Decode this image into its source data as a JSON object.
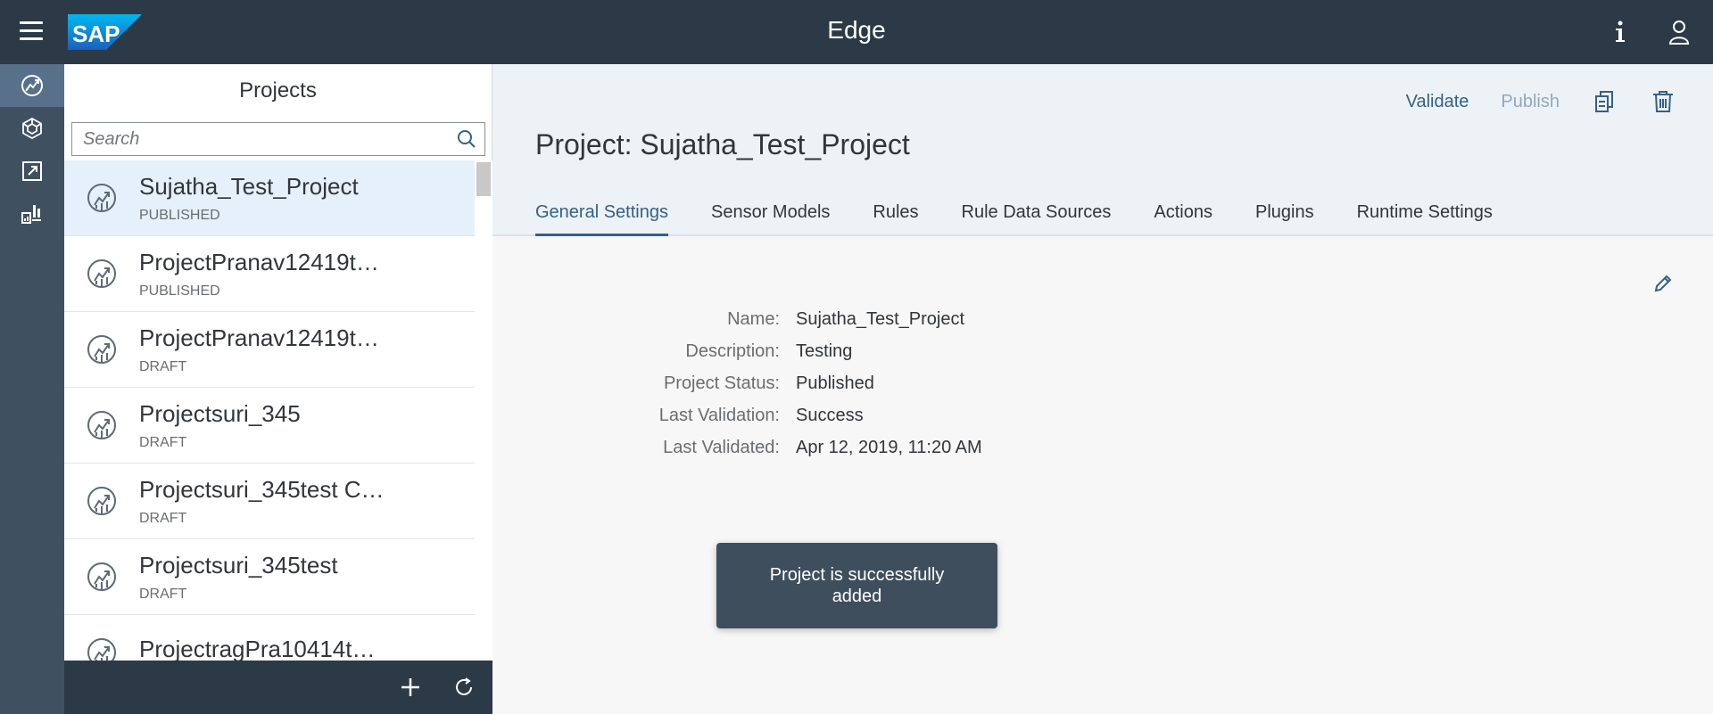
{
  "shell": {
    "title": "Edge",
    "logo_text": "SAP",
    "colors": {
      "shellbar": "#2c3a47",
      "navrail": "#3f5161",
      "accent": "#346187"
    }
  },
  "navrail": {
    "items": [
      {
        "icon": "projects-icon",
        "active": true
      },
      {
        "icon": "sensor-models-icon",
        "active": false
      },
      {
        "icon": "external-link-icon",
        "active": false
      },
      {
        "icon": "dashboard-icon",
        "active": false
      }
    ]
  },
  "master": {
    "title": "Projects",
    "search_placeholder": "Search",
    "items": [
      {
        "title": "Sujatha_Test_Project",
        "status": "PUBLISHED"
      },
      {
        "title": "ProjectPranav12419t…",
        "status": "PUBLISHED"
      },
      {
        "title": "ProjectPranav12419t…",
        "status": "DRAFT"
      },
      {
        "title": "Projectsuri_345",
        "status": "DRAFT"
      },
      {
        "title": "Projectsuri_345test C…",
        "status": "DRAFT"
      },
      {
        "title": "Projectsuri_345test",
        "status": "DRAFT"
      },
      {
        "title": "ProjectragPra10414t…",
        "status": ""
      }
    ]
  },
  "detail": {
    "title": "Project: Sujatha_Test_Project",
    "actions": {
      "validate": "Validate",
      "publish": "Publish"
    },
    "tabs": [
      {
        "label": "General Settings"
      },
      {
        "label": "Sensor Models"
      },
      {
        "label": "Rules"
      },
      {
        "label": "Rule Data Sources"
      },
      {
        "label": "Actions"
      },
      {
        "label": "Plugins"
      },
      {
        "label": "Runtime Settings"
      }
    ],
    "form": {
      "name_label": "Name:",
      "name_value": "Sujatha_Test_Project",
      "description_label": "Description:",
      "description_value": "Testing",
      "status_label": "Project Status:",
      "status_value": "Published",
      "last_validation_label": "Last Validation:",
      "last_validation_value": "Success",
      "last_validated_label": "Last Validated:",
      "last_validated_value": "Apr 12, 2019, 11:20 AM"
    }
  },
  "toast": {
    "message": "Project is successfully added"
  }
}
